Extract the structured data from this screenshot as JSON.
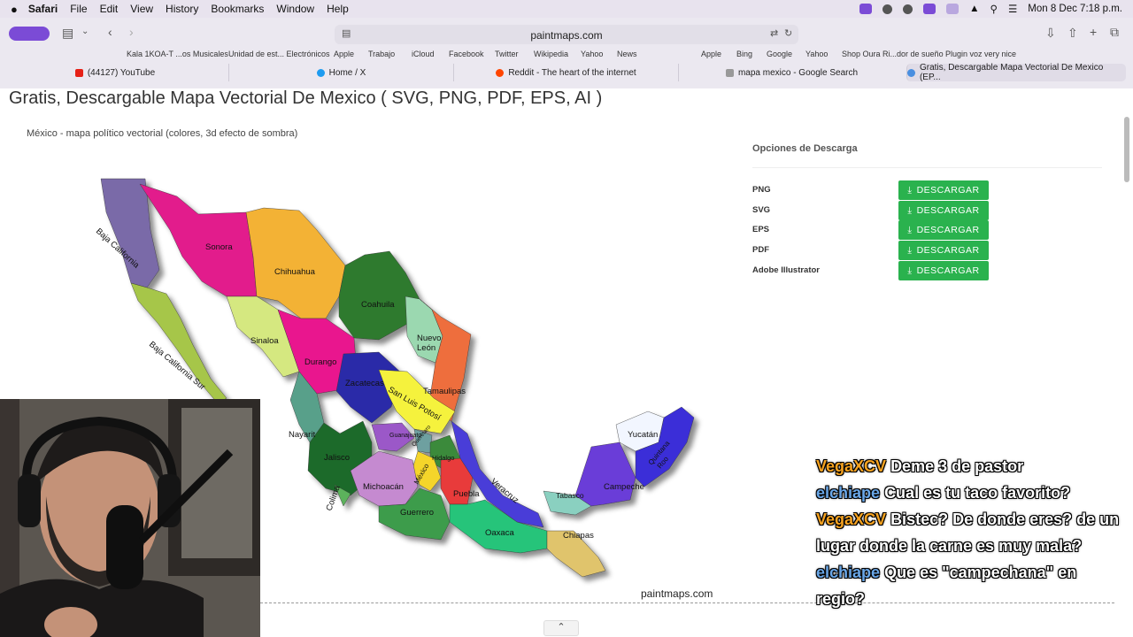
{
  "menubar": {
    "app": "Safari",
    "items": [
      "File",
      "Edit",
      "View",
      "History",
      "Bookmarks",
      "Window",
      "Help"
    ],
    "clock": "Mon 8 Dec  7:18 p.m."
  },
  "toolbar": {
    "url": "paintmaps.com"
  },
  "bookmarks": [
    "Kala 1KOA-T ...os Musicales",
    "Unidad de est... Electrónicos",
    "Apple",
    "Trabajo",
    "iCloud",
    "Facebook",
    "Twitter",
    "Wikipedia",
    "Yahoo",
    "News",
    "Apple",
    "Bing",
    "Google",
    "Yahoo",
    "Shop Oura Ri...dor de sueño",
    "Plugin voz very nice"
  ],
  "tabs": [
    {
      "label": "(44127) YouTube"
    },
    {
      "label": "Home / X"
    },
    {
      "label": "Reddit - The heart of the internet"
    },
    {
      "label": "mapa mexico - Google Search"
    },
    {
      "label": "Gratis, Descargable Mapa Vectorial De Mexico (EP..."
    }
  ],
  "page": {
    "title": "Gratis, Descargable Mapa Vectorial De Mexico ( SVG, PNG, PDF, EPS, AI )",
    "map_caption": "México - mapa político vectorial (colores, 3d efecto de sombra)",
    "credit": "paintmaps.com"
  },
  "map_labels": {
    "baja_california": "Baja California",
    "bcs": "Baja California Sur",
    "sonora": "Sonora",
    "chihuahua": "Chihuahua",
    "coahuila": "Coahuila",
    "nuevo": "Nuevo",
    "leon": "León",
    "sinaloa": "Sinaloa",
    "durango": "Durango",
    "zacatecas": "Zacatecas",
    "slp": "San Luis Potosí",
    "tamaulipas": "Tamaulipas",
    "nayarit": "Nayarit",
    "jalisco": "Jalisco",
    "guanajuato": "Guanajuato",
    "queretaro": "Querétaro",
    "hidalgo": "Hidalgo",
    "mexico": "México",
    "michoacan": "Michoacán",
    "puebla": "Puebla",
    "veracruz": "Veracruz",
    "colima": "Colima",
    "guerrero": "Guerrero",
    "oaxaca": "Oaxaca",
    "chiapas": "Chiapas",
    "tabasco": "Tabasco",
    "campeche": "Campeche",
    "yucatan": "Yucatán",
    "quintana": "Quintana",
    "roo": "Roo"
  },
  "downloads": {
    "title": "Opciones de Descarga",
    "button_label": "DESCARGAR",
    "rows": [
      {
        "format": "PNG"
      },
      {
        "format": "SVG"
      },
      {
        "format": "EPS"
      },
      {
        "format": "PDF"
      },
      {
        "format": "Adobe Illustrator"
      }
    ]
  },
  "chat": [
    {
      "user": "VegaXCV",
      "message": "Deme 3 de pastor"
    },
    {
      "user": "elchiape",
      "message": "Cual es tu taco favorito?"
    },
    {
      "user": "VegaXCV",
      "message": "Bistec? De donde eres? de un lugar donde la carne es muy mala?"
    },
    {
      "user": "elchiape",
      "message": "Que es \"campechana\" en regio?"
    }
  ],
  "colors": {
    "download_button": "#2ab24e",
    "chat_orange": "#f7a320",
    "chat_blue": "#6aa7e8"
  }
}
